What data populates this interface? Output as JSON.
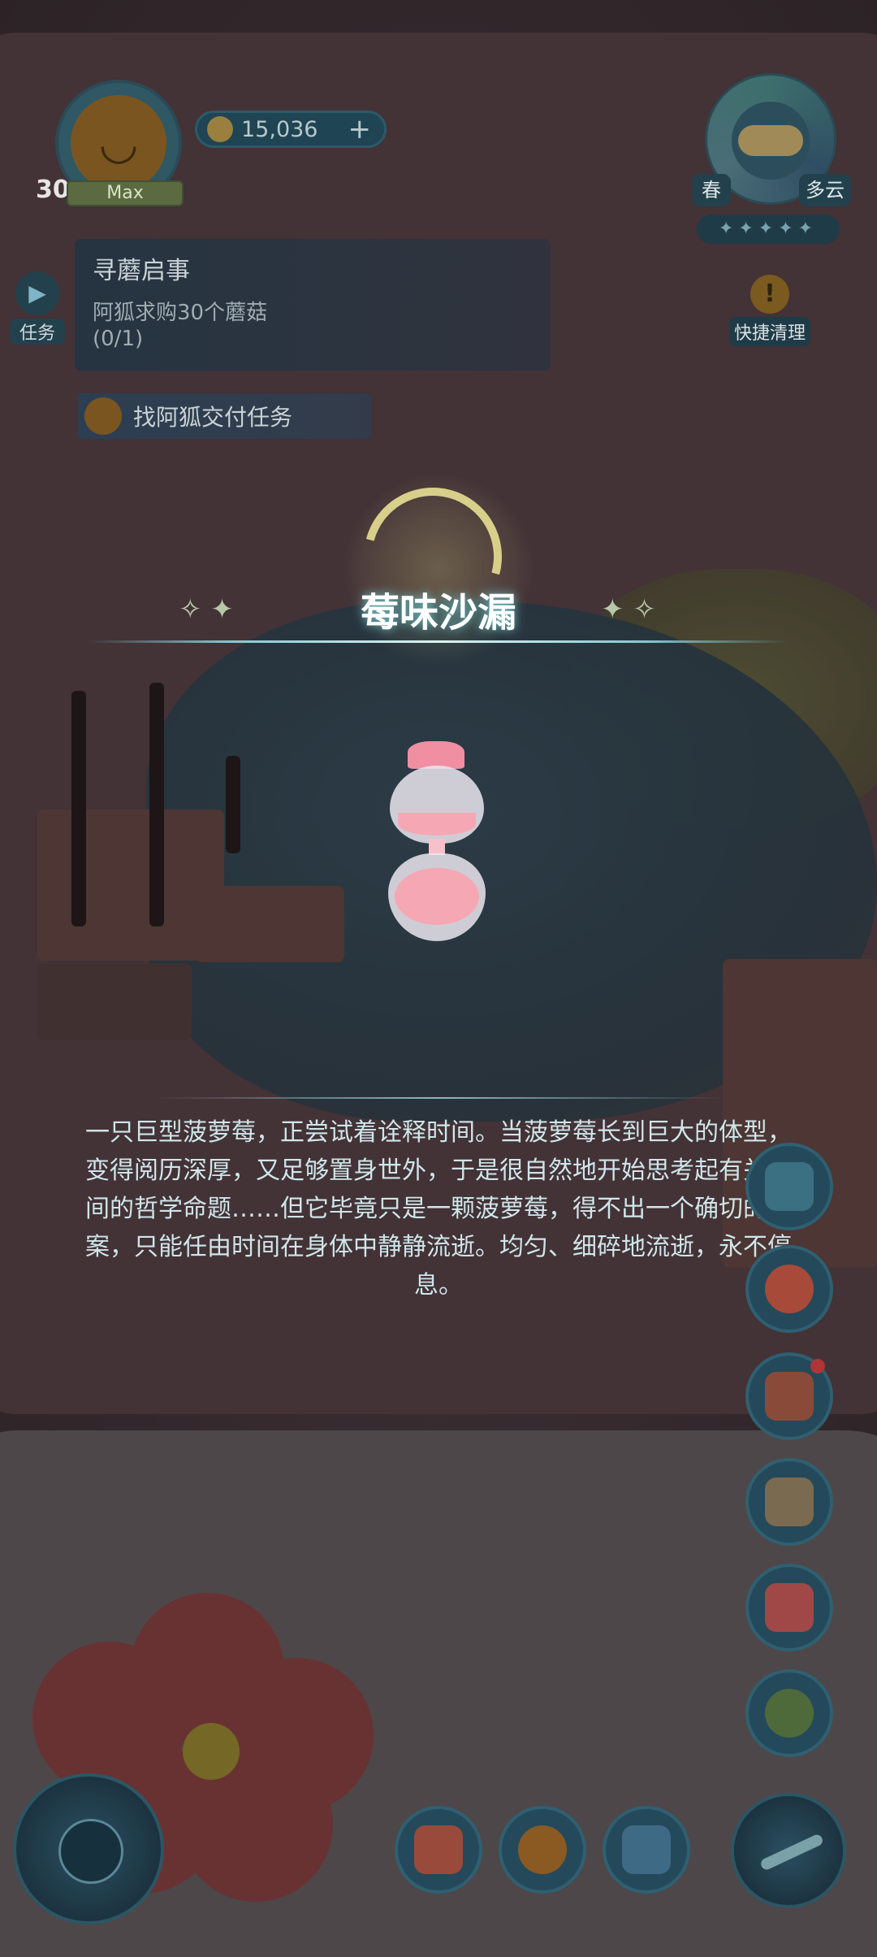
{
  "hud": {
    "player_level": "30",
    "level_status": "Max",
    "coins": "15,036",
    "coin_plus": "+"
  },
  "weather": {
    "season": "春",
    "condition": "多云",
    "stars": "✦✦✦✦✦",
    "quick_clear_label": "快捷清理"
  },
  "quest": {
    "tab_label": "任务",
    "title": "寻蘑启事",
    "description": "阿狐求购30个蘑菇",
    "progress": "(0/1)",
    "deliver_label": "找阿狐交付任务"
  },
  "item": {
    "name": "莓味沙漏",
    "description": "一只巨型菠萝莓，正尝试着诠释时间。当菠萝莓长到巨大的体型，变得阅历深厚，又足够置身世外，于是很自然地开始思考起有关时间的哲学命题……但它毕竟只是一颗菠萝莓，得不出一个确切的答案，只能任由时间在身体中静静流逝。均匀、细碎地流逝，永不停息。"
  },
  "colors": {
    "title_glow": "#6fc0c8",
    "sand_pink": "#f5a8b4",
    "panel_bg": "#243442",
    "button_teal": "#24495a"
  }
}
